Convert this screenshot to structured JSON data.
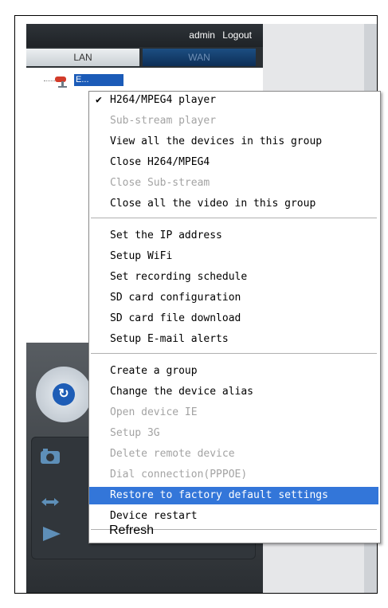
{
  "header": {
    "user": "admin",
    "logout": "Logout"
  },
  "tabs": {
    "lan": "LAN",
    "wan": "WAN"
  },
  "device": {
    "label": "E..."
  },
  "menu": {
    "items": [
      "H264/MPEG4 player",
      "Sub-stream player",
      "View all the devices in this group",
      "Close H264/MPEG4",
      "Close Sub-stream",
      "Close all the video in this group",
      "Set the IP address",
      "Setup WiFi",
      "Set recording schedule",
      "SD card configuration",
      "SD card file download",
      "Setup E-mail alerts",
      "Create a group",
      "Change the device alias",
      "Open device IE",
      "Setup 3G",
      "Delete remote device",
      "Dial connection(PPPOE)",
      "Restore to factory default settings",
      "Device restart",
      "Refresh"
    ],
    "checked_glyph": "✔",
    "disabled": [
      "Sub-stream player",
      "Close Sub-stream",
      "Open device IE",
      "Setup 3G",
      "Delete remote device",
      "Dial connection(PPPOE)"
    ],
    "highlighted": "Restore to factory default settings",
    "highlight_color": "#3376d9"
  },
  "icons": {
    "camera": "camera-icon",
    "ptz_refresh": "refresh-icon",
    "snapshot": "snapshot-icon",
    "swap": "swap-arrows-icon",
    "play": "play-icon"
  },
  "colors": {
    "accent": "#1e5db6",
    "menu_selected": "#3376d9"
  }
}
